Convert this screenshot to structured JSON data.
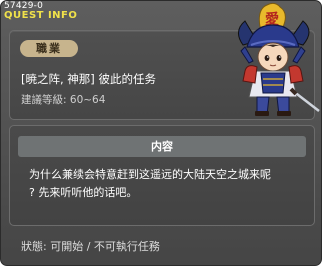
{
  "window": {
    "quest_id": "57429-0",
    "title": "QUEST INFO"
  },
  "info": {
    "job_badge": "職業",
    "quest_name": "[暁之阵, 神那] 彼此的任务",
    "level_label": "建議等級:",
    "level_range": "60~64"
  },
  "npc": {
    "icon": "samurai-npc-portrait",
    "helmet_color": "#2a3a8c",
    "crest_color": "#e8b92c"
  },
  "content": {
    "header": "内容",
    "line1": "为什么兼续会特意赶到这遥远的大陆天空之城来呢",
    "line2": "? 先来听听他的话吧。"
  },
  "status": {
    "text": "狀態: 可開始 / 不可執行任務"
  },
  "colors": {
    "title_yellow": "#f1e24a",
    "badge_tan": "#c7b48d",
    "panel_bg": "#4a4a4a"
  }
}
